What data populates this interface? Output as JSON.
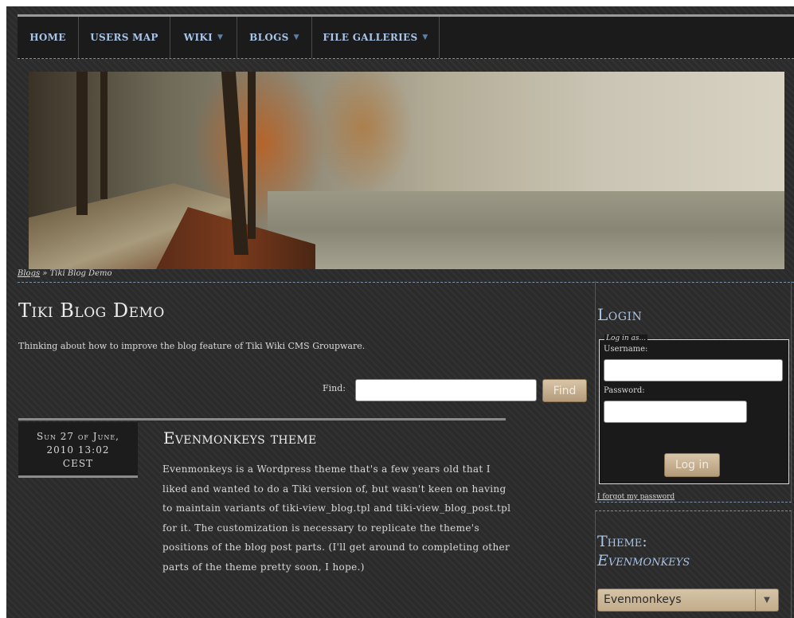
{
  "nav": {
    "items": [
      {
        "label": "HOME",
        "dropdown": false
      },
      {
        "label": "USERS MAP",
        "dropdown": false
      },
      {
        "label": "WIKI",
        "dropdown": true
      },
      {
        "label": "BLOGS",
        "dropdown": true
      },
      {
        "label": "FILE GALLERIES",
        "dropdown": true
      }
    ]
  },
  "breadcrumb": {
    "link": "Blogs",
    "separator": "»",
    "current": "Tiki Blog Demo"
  },
  "blog": {
    "title": "Tiki Blog Demo",
    "description": "Thinking about how to improve the blog feature of Tiki Wiki CMS Groupware."
  },
  "find": {
    "label": "Find:",
    "value": "",
    "button": "Find"
  },
  "post": {
    "date_line1": "Sun 27 of June,",
    "date_line2": "2010 13:02",
    "date_line3": "CEST",
    "title": "Evenmonkeys theme",
    "body": "Evenmonkeys is a Wordpress theme that's a few years old that I liked and wanted to do a Tiki version of, but wasn't keen on having to maintain variants of tiki-view_blog.tpl and tiki-view_blog_post.tpl for it. The customization is necessary to replicate the theme's positions of the blog post parts. (I'll get around to completing other parts of the theme pretty soon, I hope.)"
  },
  "login": {
    "title": "Login",
    "legend": "Log in as...",
    "username_label": "Username:",
    "username_value": "",
    "password_label": "Password:",
    "password_value": "",
    "button": "Log in",
    "forgot": "I forgot my password"
  },
  "theme": {
    "title_line1": "Theme:",
    "title_line2": "Evenmonkeys",
    "selected": "Evenmonkeys"
  },
  "colors": {
    "background": "#2b2b2b",
    "nav_text": "#a9c4e6",
    "button": "#c7b290",
    "text": "#d9d9d9"
  },
  "icons": {
    "nav_dropdown": "caret-down-icon",
    "select_arrow": "chevron-down-icon"
  }
}
